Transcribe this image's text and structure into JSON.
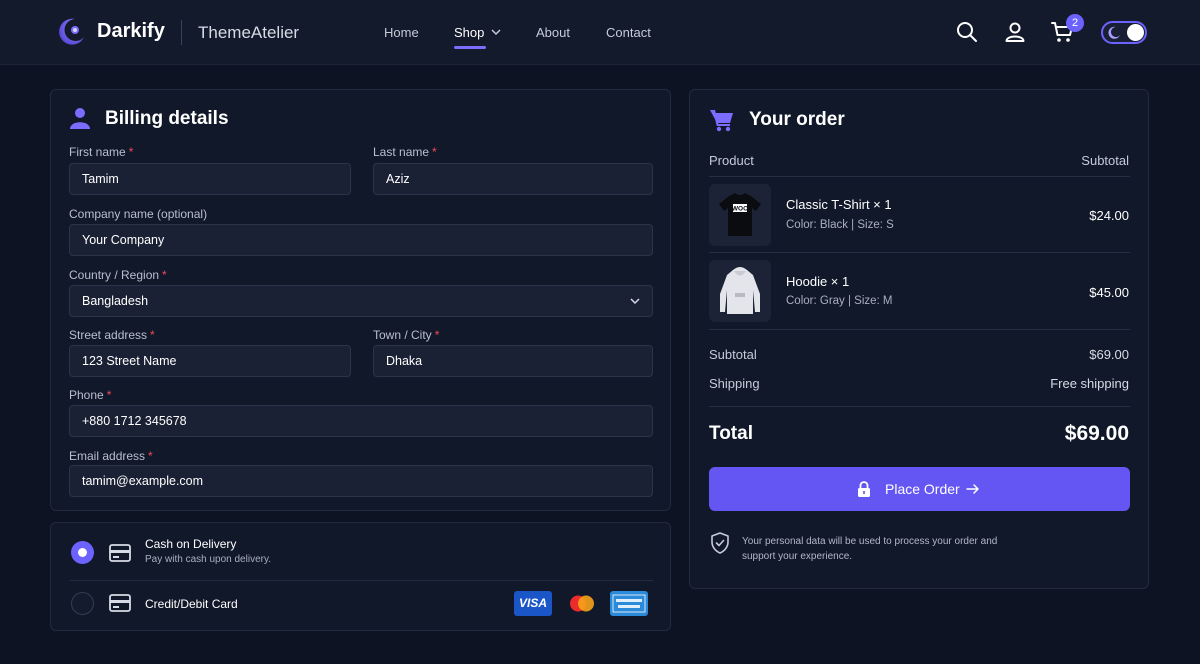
{
  "header": {
    "logo_text": "Darkify",
    "brand": "ThemeAtelier",
    "nav": [
      {
        "label": "Home"
      },
      {
        "label": "Shop"
      },
      {
        "label": "About"
      },
      {
        "label": "Contact"
      }
    ],
    "active_nav": "Shop",
    "cart_count": "2",
    "icons": [
      "search-icon",
      "user-icon",
      "cart-icon",
      "moon-icon"
    ],
    "accent_color": "#6c63ff"
  },
  "billing": {
    "title": "Billing details",
    "first_name_label": "First name",
    "first_name_value": "Tamim",
    "last_name_label": "Last name",
    "last_name_value": "Aziz",
    "company_label": "Company name (optional)",
    "company_value": "Your Company",
    "country_label": "Country / Region",
    "country_value": "Bangladesh",
    "street_label": "Street address",
    "street_value": "123 Street Name",
    "town_label": "Town / City",
    "town_value": "Dhaka",
    "phone_label": "Phone",
    "phone_value": "+880 1712 345678",
    "email_label": "Email address",
    "email_value": "tamim@example.com",
    "required_mark": "*"
  },
  "payment": {
    "methods": [
      {
        "title": "Cash on Delivery",
        "subtitle": "Pay with cash upon delivery.",
        "selected": true
      },
      {
        "title": "Credit/Debit Card",
        "selected": false
      }
    ],
    "card_brands": [
      "VISA",
      "mastercard",
      "AMERICAN EXPRESS"
    ]
  },
  "order": {
    "title": "Your order",
    "col_product": "Product",
    "col_subtotal": "Subtotal",
    "items": [
      {
        "name": "Classic T-Shirt  × 1",
        "meta": "Color: Black | Size: S",
        "price": "$24.00",
        "print": "WOO"
      },
      {
        "name": "Hoodie  × 1",
        "meta": "Color: Gray | Size: M",
        "price": "$45.00"
      }
    ],
    "subtotal_label": "Subtotal",
    "subtotal_value": "$69.00",
    "shipping_label": "Shipping",
    "shipping_value": "Free shipping",
    "total_label": "Total",
    "total_value": "$69.00",
    "place_order_label": "Place Order",
    "privacy_text": "Your personal data will be used to process your order and support your experience.",
    "button_color": "#6456f2"
  }
}
